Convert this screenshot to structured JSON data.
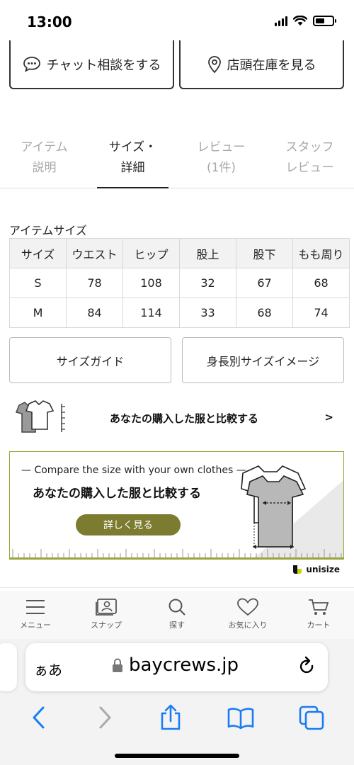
{
  "status_bar": {
    "time": "13:00"
  },
  "top_actions": {
    "chat": "チャット相談をする",
    "store_stock": "店頭在庫を見る"
  },
  "tabs": [
    {
      "line1": "アイテム",
      "line2": "説明",
      "active": false
    },
    {
      "line1": "サイズ・",
      "line2": "詳細",
      "active": true
    },
    {
      "line1": "レビュー",
      "line2": "(1件)",
      "active": false
    },
    {
      "line1": "スタッフ",
      "line2": "レビュー",
      "active": false
    }
  ],
  "size_table": {
    "title": "アイテムサイズ",
    "headers": [
      "サイズ",
      "ウエスト",
      "ヒップ",
      "股上",
      "股下",
      "もも周り"
    ],
    "rows": [
      [
        "S",
        "78",
        "108",
        "32",
        "67",
        "68"
      ],
      [
        "M",
        "84",
        "114",
        "33",
        "68",
        "74"
      ]
    ]
  },
  "size_buttons": {
    "guide": "サイズガイド",
    "by_height": "身長別サイズイメージ"
  },
  "compare": {
    "text": "あなたの購入した服と比較する",
    "arrow": ">"
  },
  "banner": {
    "en": "— Compare the size with your own clothes —",
    "jp": "あなたの購入した服と比較する",
    "button": "詳しく見る",
    "accent": "#7b7c2f"
  },
  "unisize": {
    "label": "unisize"
  },
  "bottom_nav": [
    {
      "label": "メニュー",
      "icon": "menu-icon"
    },
    {
      "label": "スナップ",
      "icon": "snap-icon"
    },
    {
      "label": "探す",
      "icon": "search-icon"
    },
    {
      "label": "お気に入り",
      "icon": "heart-icon"
    },
    {
      "label": "カート",
      "icon": "cart-icon"
    }
  ],
  "browser": {
    "aa": "ぁあ",
    "url": "baycrews.jp"
  }
}
